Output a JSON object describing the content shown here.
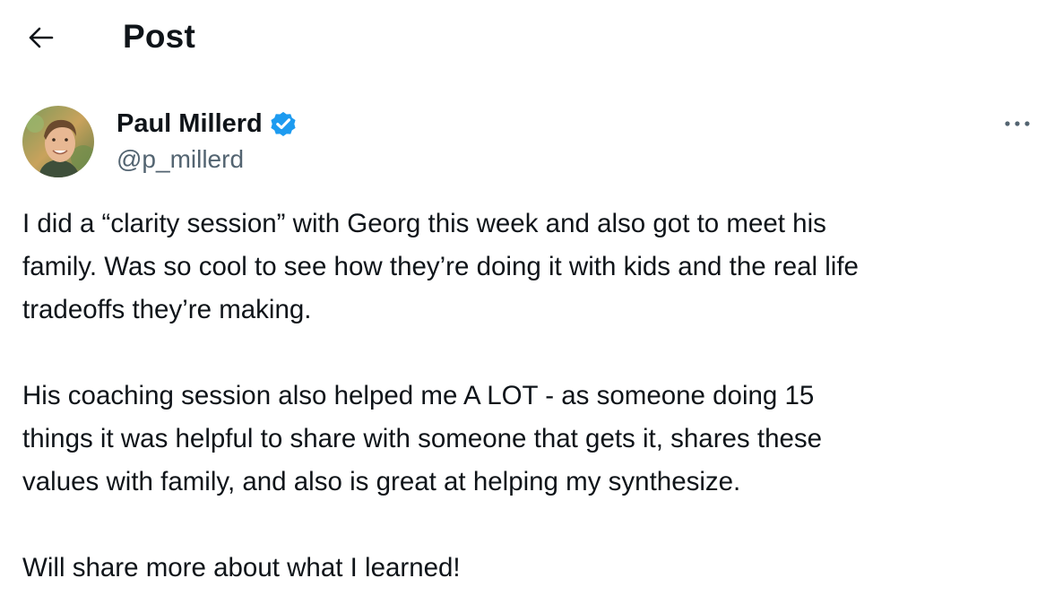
{
  "header": {
    "back_icon": "arrow-left-icon",
    "title": "Post"
  },
  "author": {
    "name": "Paul Millerd",
    "handle": "@p_millerd",
    "verified": true,
    "verified_color": "#1d9bf0",
    "more_icon": "ellipsis-icon"
  },
  "post": {
    "paragraphs": [
      "I did a “clarity session” with Georg this week and also got to meet his\nfamily. Was so cool to see how they’re doing it with kids and the real life\ntradeoffs they’re making.",
      "His coaching session also helped me A LOT - as someone doing 15\nthings it was helpful to share with someone that gets it, shares these\nvalues with family, and also is great at helping my synthesize.",
      "Will share more about what I learned!"
    ]
  },
  "colors": {
    "text_primary": "#0f1419",
    "text_secondary": "#536471",
    "accent": "#1d9bf0"
  }
}
